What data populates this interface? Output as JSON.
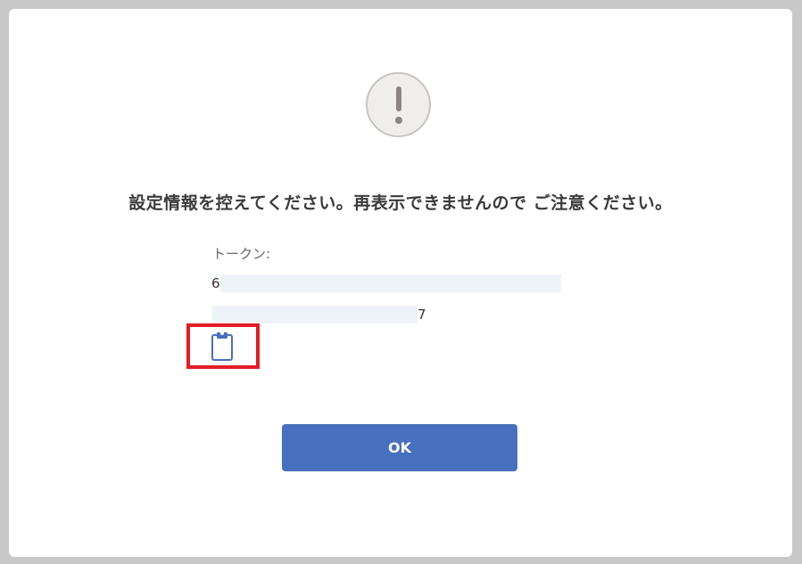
{
  "dialog": {
    "message": "設定情報を控えてください。再表示できませんので ご注意ください。",
    "token": {
      "label": "トークン:",
      "line1_visible": "6",
      "line2_visible": "7"
    },
    "copy_icon": "clipboard-icon",
    "ok_label": "OK"
  },
  "colors": {
    "accent": "#4770be",
    "highlight": "#e21d25",
    "mask": "#eef3f8"
  }
}
